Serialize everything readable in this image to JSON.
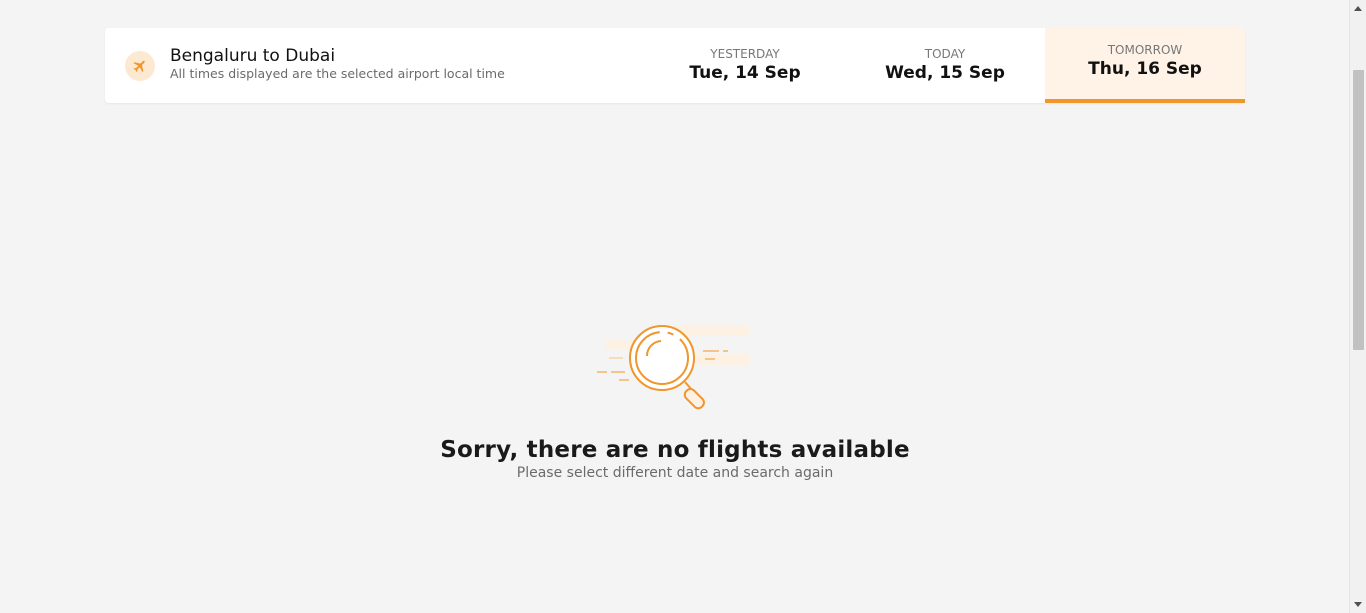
{
  "header": {
    "route_title": "Bengaluru to Dubai",
    "route_subtitle": "All times displayed are the selected airport local time",
    "route_icon": "airplane-icon"
  },
  "date_tabs": [
    {
      "label": "YESTERDAY",
      "date": "Tue, 14 Sep",
      "active": false
    },
    {
      "label": "TODAY",
      "date": "Wed, 15 Sep",
      "active": false
    },
    {
      "label": "TOMORROW",
      "date": "Thu, 16 Sep",
      "active": true
    }
  ],
  "empty_state": {
    "icon": "magnifying-glass-icon",
    "title": "Sorry, there are no flights available",
    "subtitle": "Please select different date and search again"
  },
  "colors": {
    "accent": "#f0962b",
    "active_tab_bg": "#fef3e6",
    "page_bg": "#f4f4f4"
  }
}
